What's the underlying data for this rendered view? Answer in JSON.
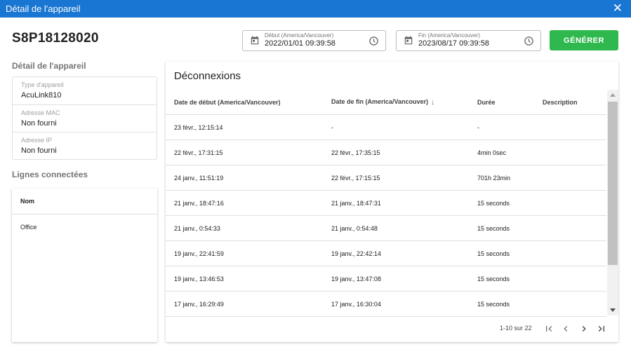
{
  "window": {
    "title": "Détail de l'appareil",
    "close_symbol": "✕"
  },
  "device": {
    "id": "S8P18128020"
  },
  "date_range": {
    "start": {
      "label": "Début (America/Vancouver)",
      "value": "2022/01/01 09:39:58"
    },
    "end": {
      "label": "Fin (America/Vancouver)",
      "value": "2023/08/17 09:39:58"
    }
  },
  "generate_label": "GÉNÉRER",
  "details": {
    "section_title": "Détail de l'appareil",
    "fields": [
      {
        "key": "Type d'appareil",
        "value": "AcuLink810"
      },
      {
        "key": "Adresse MAC",
        "value": "Non fourni"
      },
      {
        "key": "Adresse IP",
        "value": "Non fourni"
      }
    ]
  },
  "lines": {
    "section_title": "Lignes connectées",
    "header": "Nom",
    "rows": [
      "Office"
    ]
  },
  "disconnections": {
    "title": "Déconnexions",
    "columns": [
      "Date de début (America/Vancouver)",
      "Date de fin (America/Vancouver)",
      "Durée",
      "Description"
    ],
    "sort_symbol": "↓",
    "rows": [
      [
        "23 févr., 12:15:14",
        "-",
        "-",
        ""
      ],
      [
        "22 févr., 17:31:15",
        "22 févr., 17:35:15",
        "4min 0sec",
        ""
      ],
      [
        "24 janv., 11:51:19",
        "22 févr., 17:15:15",
        "701h 23min",
        ""
      ],
      [
        "21 janv., 18:47:16",
        "21 janv., 18:47:31",
        "15 seconds",
        ""
      ],
      [
        "21 janv., 0:54:33",
        "21 janv., 0:54:48",
        "15 seconds",
        ""
      ],
      [
        "19 janv., 22:41:59",
        "19 janv., 22:42:14",
        "15 seconds",
        ""
      ],
      [
        "19 janv., 13:46:53",
        "19 janv., 13:47:08",
        "15 seconds",
        ""
      ],
      [
        "17 janv., 16:29:49",
        "17 janv., 16:30:04",
        "15 seconds",
        ""
      ]
    ],
    "pagination": {
      "range": "1-10 sur 22"
    }
  },
  "colors": {
    "titlebar": "#1976d2",
    "generate_button": "#2fb84e"
  },
  "icons": [
    "close-icon",
    "calendar-icon",
    "clock-icon",
    "sort-down-icon",
    "first-page-icon",
    "previous-page-icon",
    "next-page-icon",
    "last-page-icon"
  ]
}
